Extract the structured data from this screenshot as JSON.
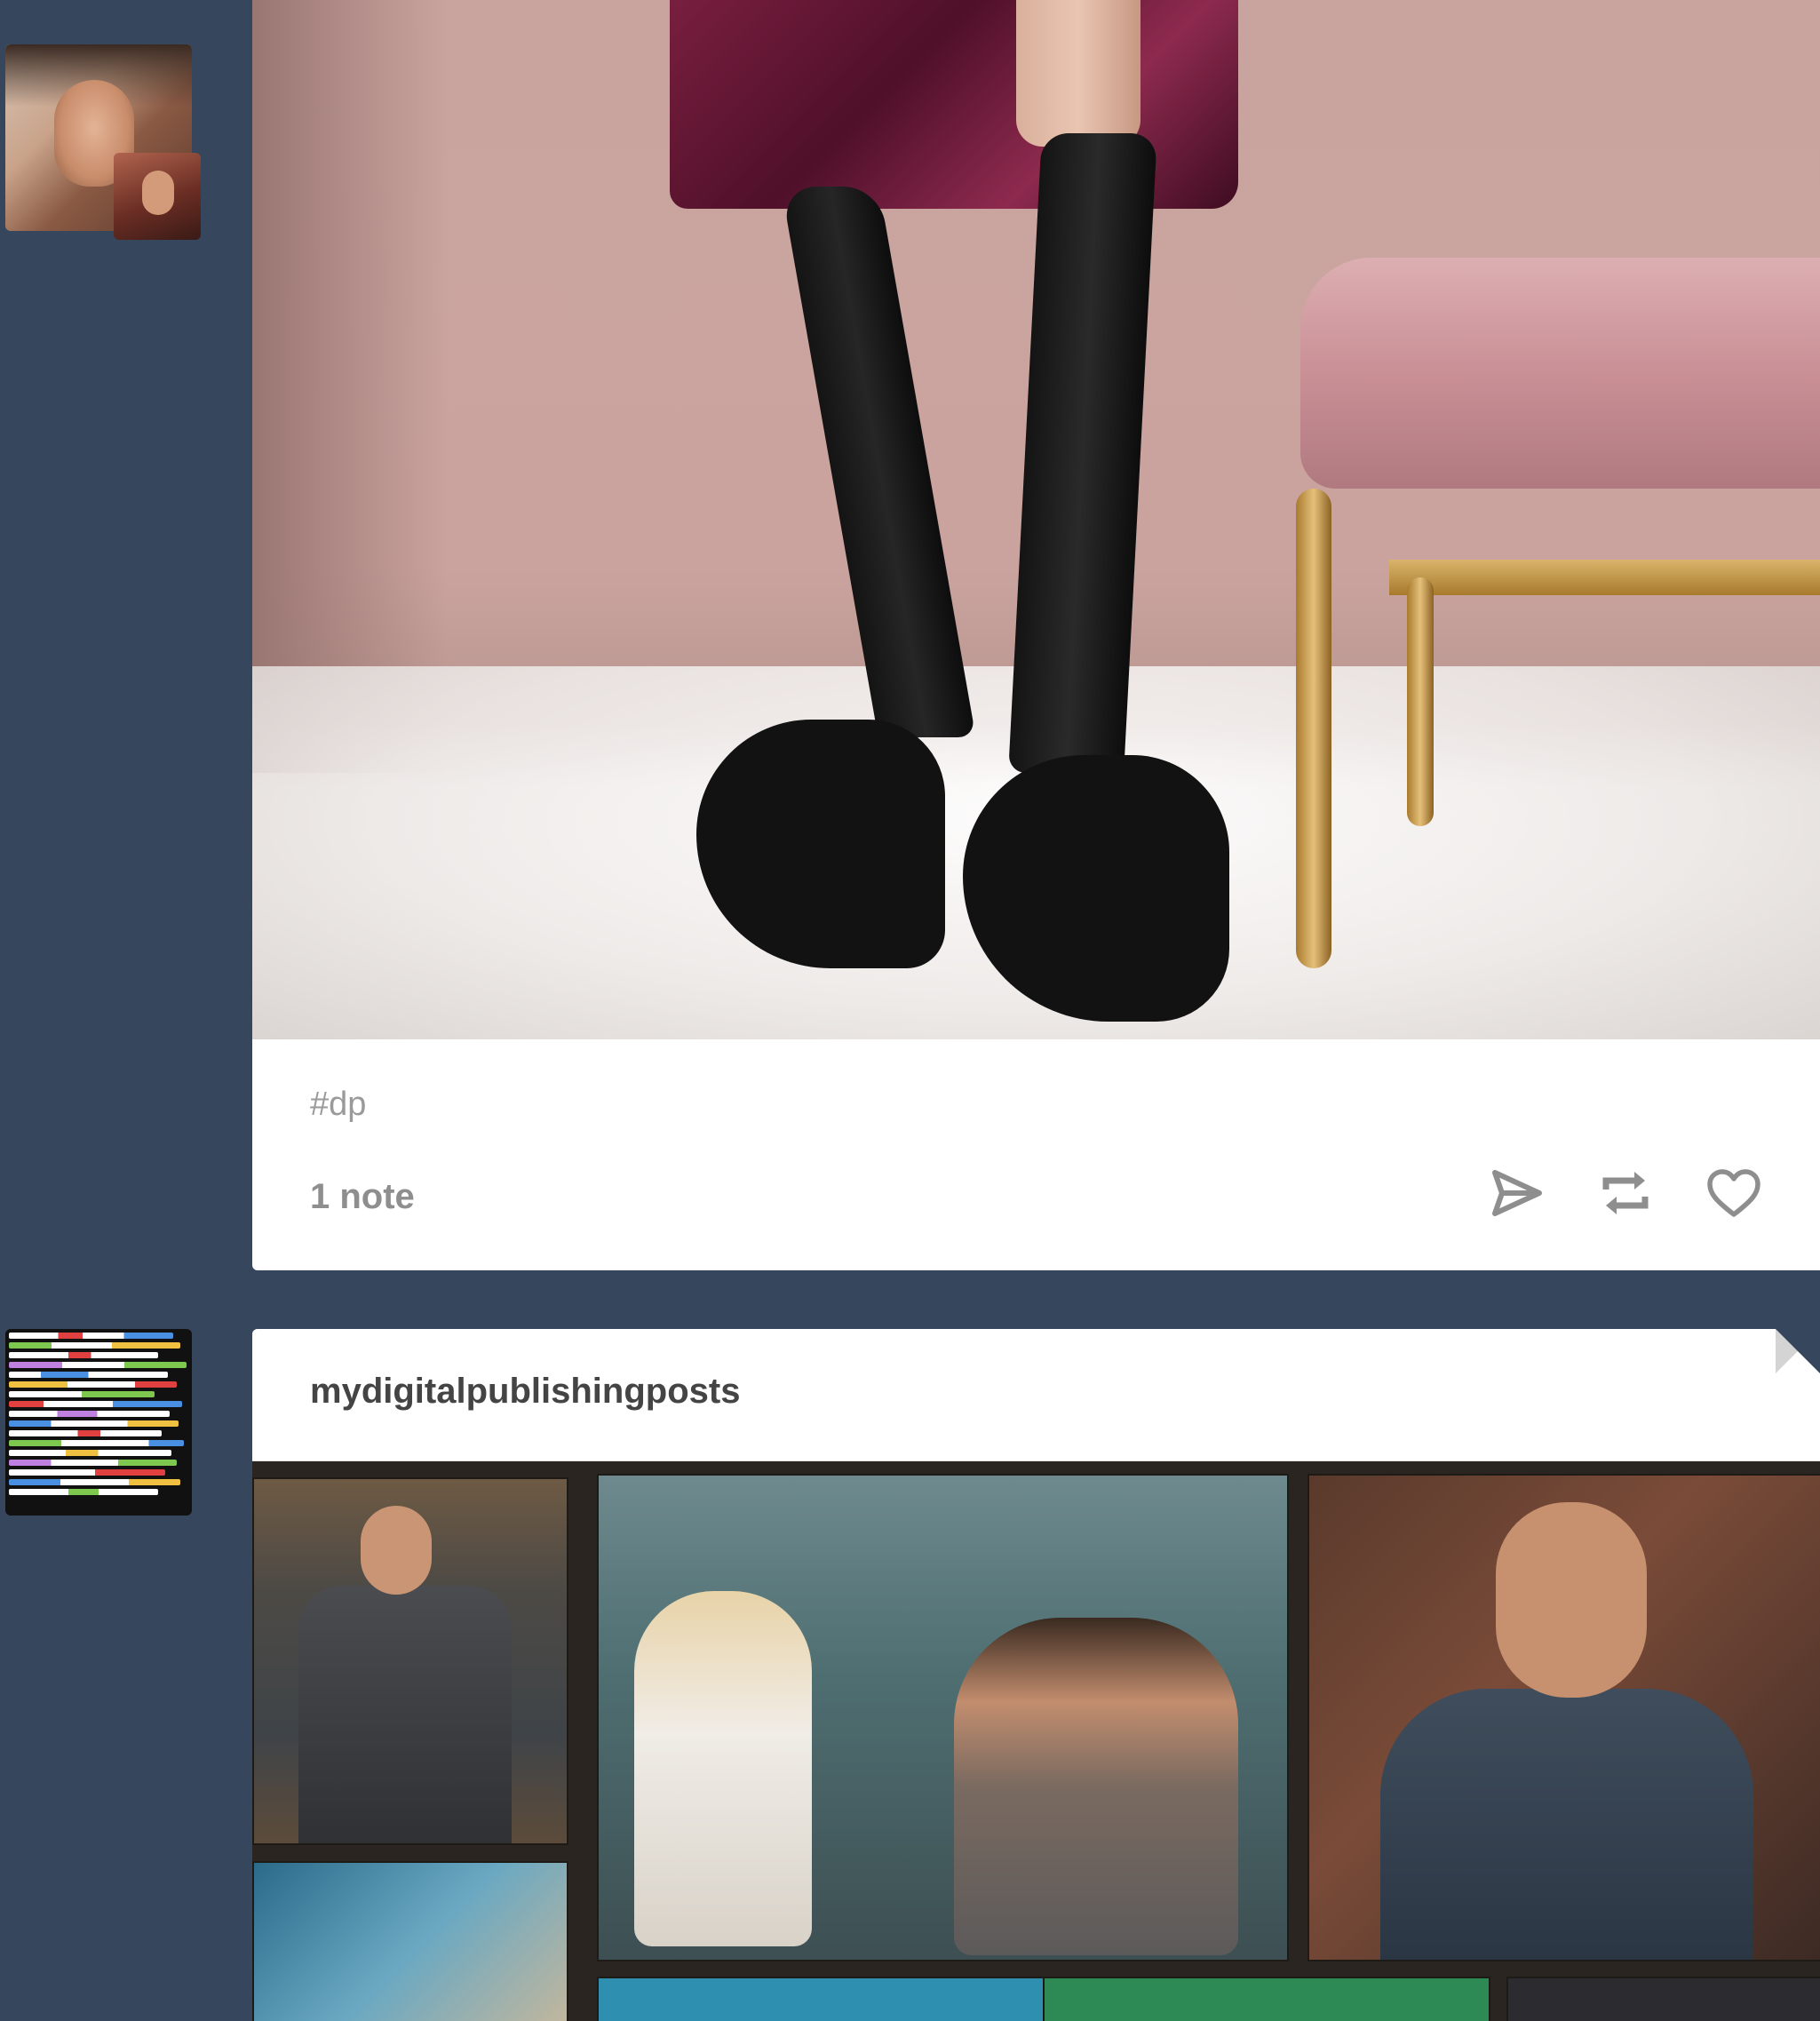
{
  "post1": {
    "tag": "#dp",
    "notes": "1 note",
    "actions": [
      {
        "icon": "send-icon"
      },
      {
        "icon": "reblog-icon"
      },
      {
        "icon": "heart-icon"
      }
    ]
  },
  "post2": {
    "blog_name": "mydigitalpublishingposts"
  },
  "colors": {
    "background": "#36465d",
    "card": "#ffffff",
    "icon": "#8e8e8e",
    "tag_text": "#9a9a9a",
    "blog_name_text": "#444444"
  }
}
